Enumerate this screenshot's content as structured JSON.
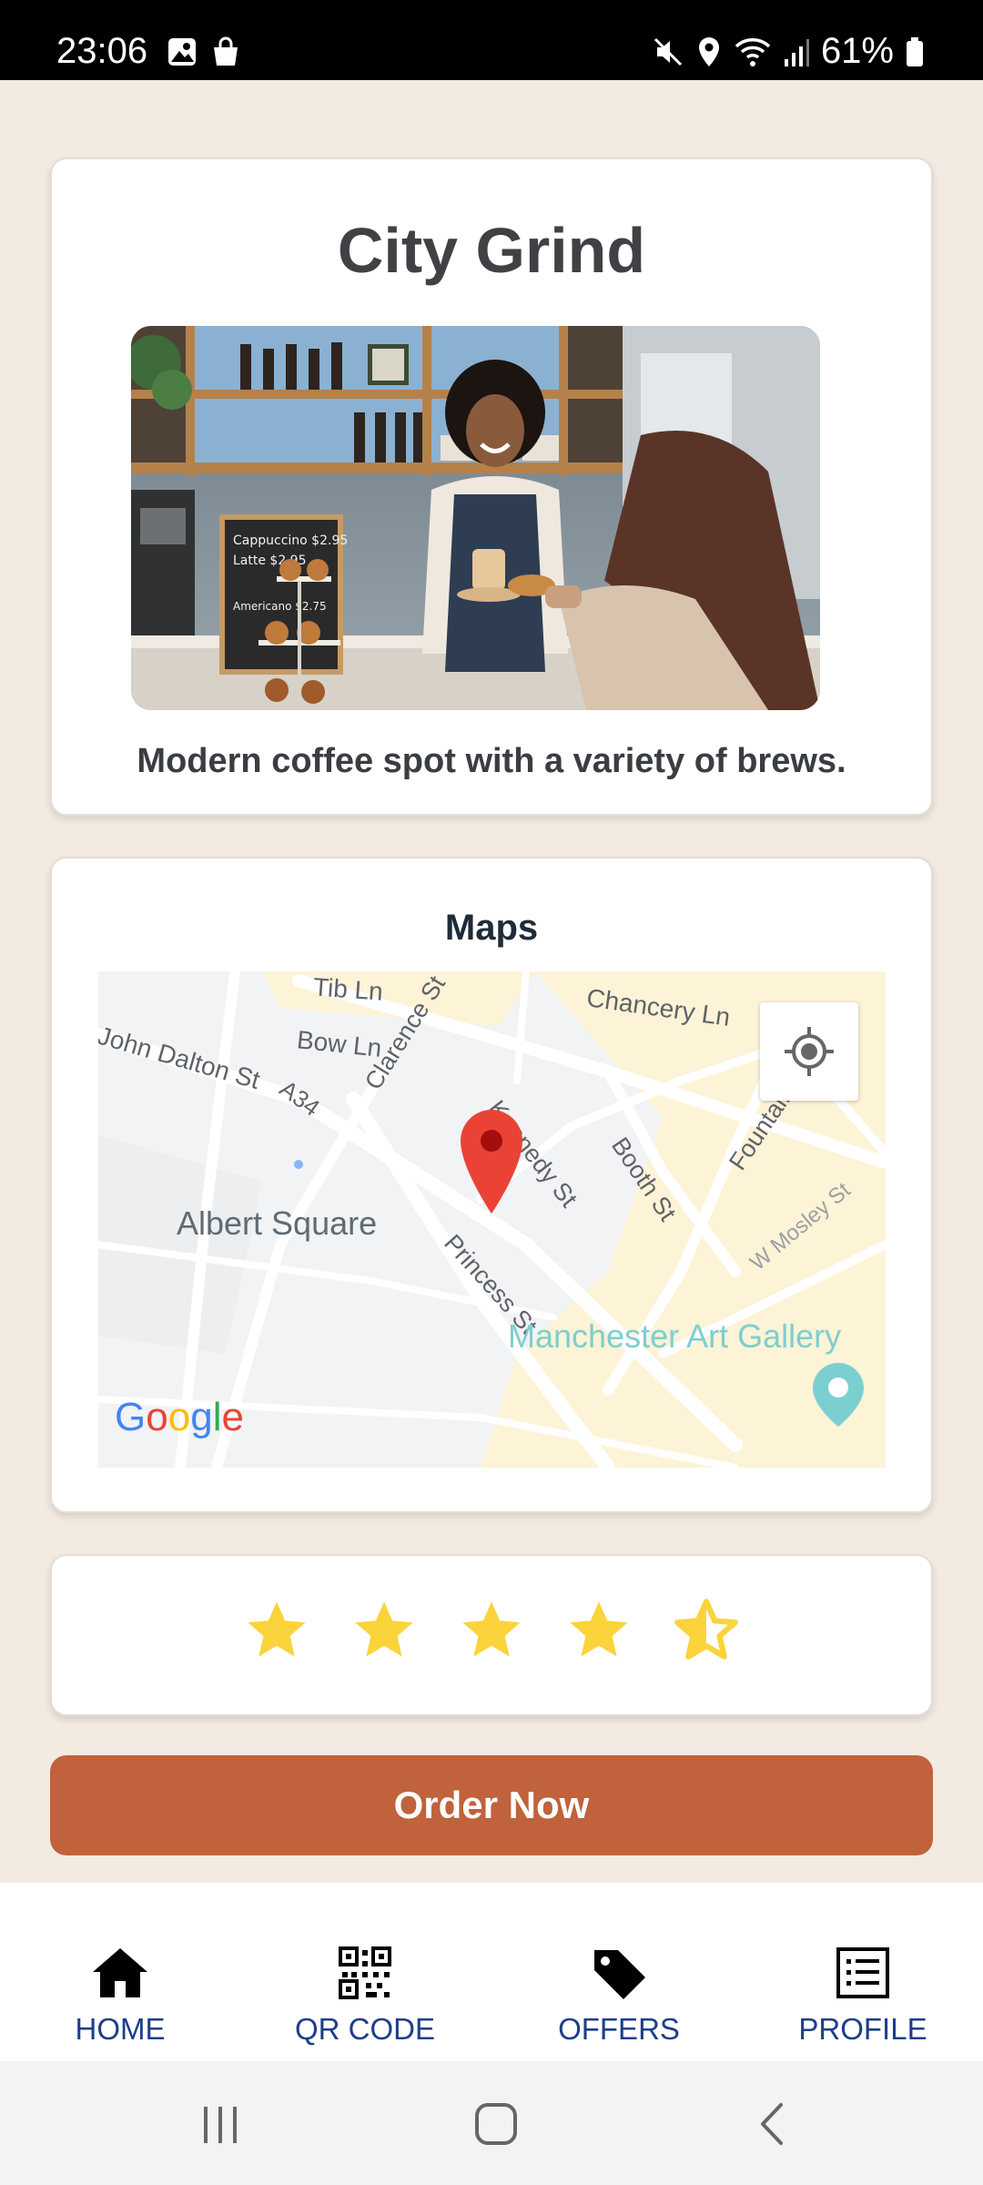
{
  "status_bar": {
    "time": "23:06",
    "battery": "61%",
    "icons": [
      "gallery-icon",
      "shopping-bag-icon",
      "mute-icon",
      "location-icon",
      "wifi-icon",
      "signal-icon",
      "battery-icon"
    ]
  },
  "shop": {
    "name": "City Grind",
    "description": "Modern coffee spot with a variety of brews.",
    "photo_chalkboard": [
      "Cappuccino $2.95",
      "Latte $2.95",
      "Americano $2.75"
    ]
  },
  "maps": {
    "title": "Maps",
    "streets": [
      "Tib Ln",
      "Chancery Ln",
      "John Dalton St",
      "Bow Ln",
      "A34",
      "Clarence St",
      "Kennedy St",
      "Booth St",
      "Fountain St",
      "W Mosley St",
      "Princess St"
    ],
    "places": [
      "Albert Square",
      "Manchester Art Gallery"
    ],
    "provider": "Google"
  },
  "rating": {
    "value": 4.5,
    "max": 5
  },
  "order_button": {
    "label": "Order Now"
  },
  "bottom_nav": {
    "items": [
      {
        "label": "HOME",
        "icon": "home-icon"
      },
      {
        "label": "QR CODE",
        "icon": "qr-code-icon"
      },
      {
        "label": "OFFERS",
        "icon": "tag-icon"
      },
      {
        "label": "PROFILE",
        "icon": "list-icon"
      }
    ]
  },
  "system_nav": [
    "recent-apps-icon",
    "home-circle-icon",
    "back-icon"
  ],
  "colors": {
    "background": "#f3ebe2",
    "accent": "#c0623c",
    "nav_text": "#1d3e8a",
    "star": "#fbd33a"
  }
}
